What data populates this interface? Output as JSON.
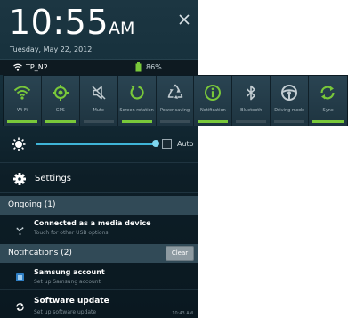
{
  "lockscreen": {
    "time": "10:55",
    "ampm": "AM",
    "date": "Tuesday, May 22, 2012"
  },
  "status": {
    "network": "TP_N2",
    "battery": "86%"
  },
  "toggles": [
    {
      "label": "Wi-Fi",
      "icon": "wifi-icon",
      "on": true
    },
    {
      "label": "GPS",
      "icon": "gps-icon",
      "on": true
    },
    {
      "label": "Mute",
      "icon": "mute-icon",
      "on": false
    },
    {
      "label": "Screen rotation",
      "icon": "rotation-icon",
      "on": true
    },
    {
      "label": "Power saving",
      "icon": "recycle-icon",
      "on": false
    },
    {
      "label": "Notification",
      "icon": "info-icon",
      "on": true
    },
    {
      "label": "Bluetooth",
      "icon": "bluetooth-icon",
      "on": false
    },
    {
      "label": "Driving mode",
      "icon": "steering-wheel-icon",
      "on": false
    },
    {
      "label": "Sync",
      "icon": "sync-icon",
      "on": true
    }
  ],
  "brightness": {
    "level": 0.98,
    "auto_label": "Auto",
    "auto_checked": false
  },
  "settings": {
    "label": "Settings"
  },
  "ongoing": {
    "header": "Ongoing (1)",
    "items": [
      {
        "title": "Connected as a media device",
        "subtitle": "Touch for other USB options",
        "icon": "usb-icon"
      }
    ]
  },
  "notifications": {
    "header": "Notifications (2)",
    "clear_label": "Clear",
    "items": [
      {
        "title": "Samsung account",
        "subtitle": "Set up Samsung account",
        "time": "",
        "icon": "samsung-account-icon"
      },
      {
        "title": "Software update",
        "subtitle": "Set up software update",
        "time": "10:43 AM",
        "icon": "software-update-icon"
      }
    ]
  },
  "colors": {
    "toggle_on": "#79c83a",
    "toggle_off": "#3a4d57",
    "accent_blue": "#3fb4d8",
    "panel_bg": "#0a1820"
  }
}
